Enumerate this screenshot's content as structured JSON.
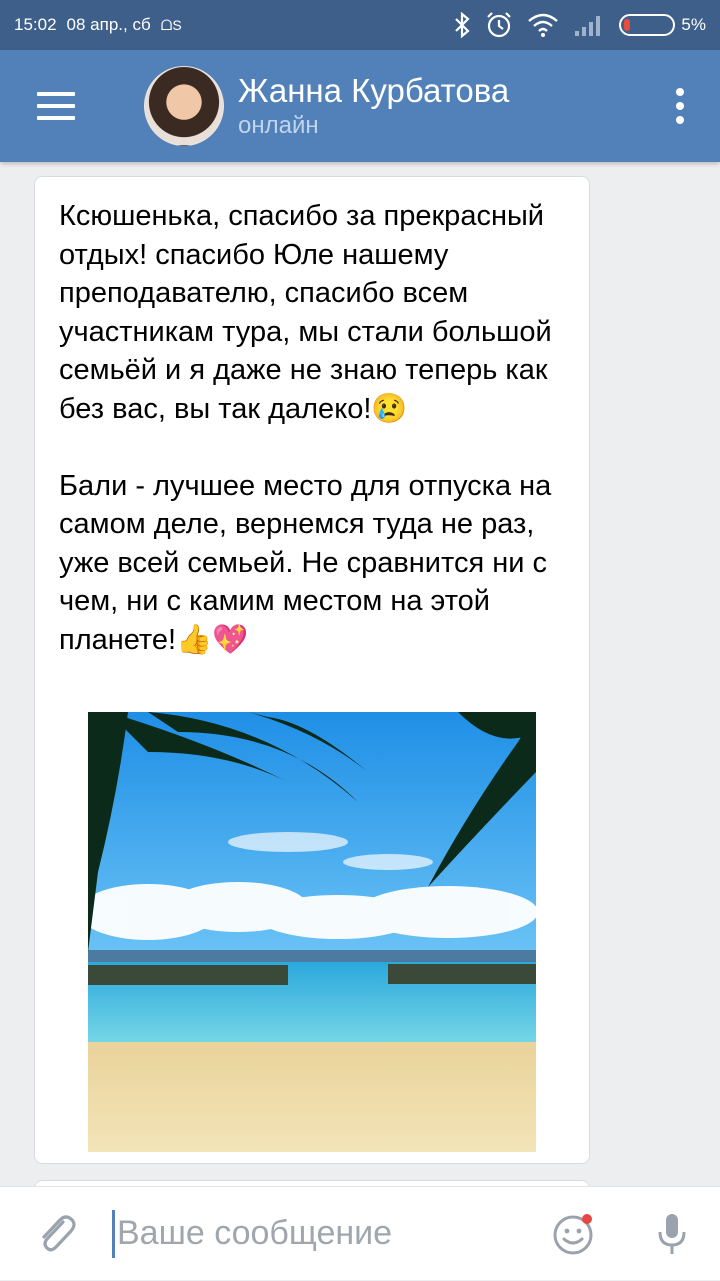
{
  "status_bar": {
    "time": "15:02",
    "date": "08 апр., сб",
    "carrier_glyph": "ᗝS",
    "battery": "5%",
    "icons": [
      "bluetooth-icon",
      "alarm-icon",
      "wifi-icon",
      "signal-icon",
      "battery-icon"
    ]
  },
  "header": {
    "name": "Жанна Курбатова",
    "status": "онлайн"
  },
  "message": {
    "paragraphs": [
      "Ксюшенька, спасибо за прекрасный отдых! спасибо Юле нашему преподавателю, спасибо всем участникам тура, мы стали большой семьёй и я даже не знаю теперь как без вас, вы так далеко!😢",
      "Бали - лучшее место для отпуска на самом деле, вернемся туда не раз, уже всей семьей. Не сравнится ни с чем, ни с камим местом на этой планете!👍💖"
    ],
    "photo_icon": "beach-photo"
  },
  "composer": {
    "placeholder": "Ваше сообщение"
  },
  "colors": {
    "header": "#5181b8",
    "status_bar": "#3d5f8a",
    "background": "#edeef0"
  }
}
